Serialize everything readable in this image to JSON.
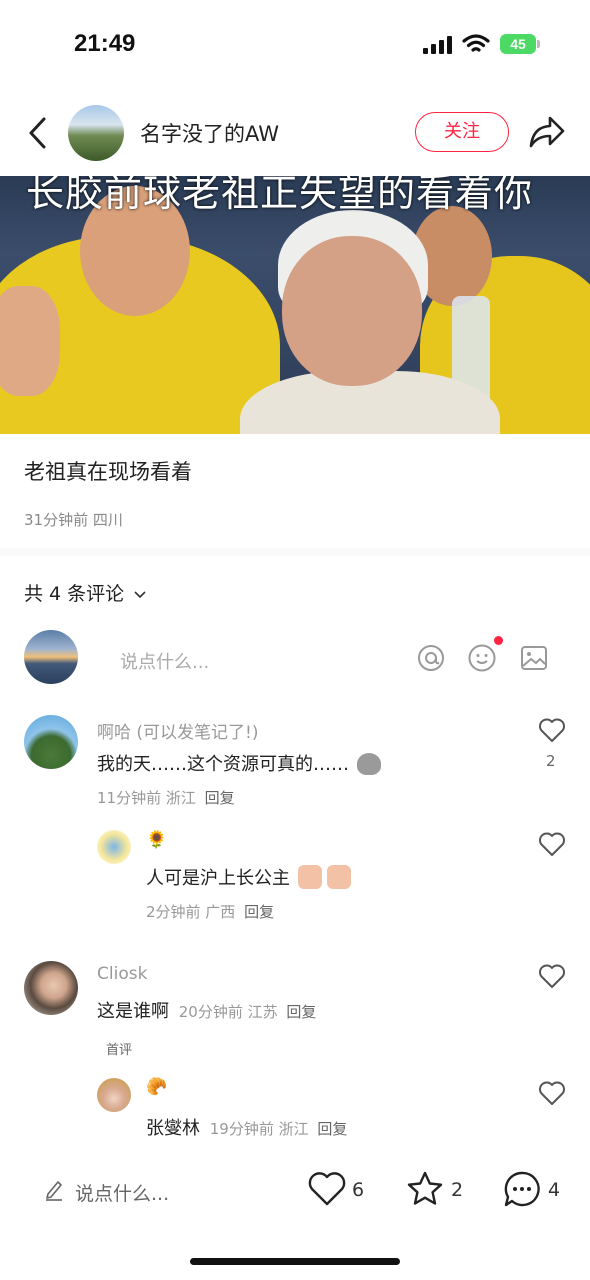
{
  "status_bar": {
    "time": "21:49",
    "battery": "45"
  },
  "nav": {
    "author_name": "名字没了的AW",
    "follow_label": "关注"
  },
  "video": {
    "caption": "长胶前球老祖正失望的看着你"
  },
  "post": {
    "title": "老祖真在现场看着",
    "meta": "31分钟前 四川"
  },
  "comments_header": {
    "count_label": "共 4 条评论"
  },
  "comment_input": {
    "placeholder": "说点什么..."
  },
  "comments": [
    {
      "name": "啊哈 (可以发笔记了!)",
      "text": "我的天……这个资源可真的……",
      "time": "11分钟前 浙江",
      "reply": "回复",
      "likes": "2"
    },
    {
      "name": "🌻",
      "text": "人可是沪上长公主",
      "time": "2分钟前 广西",
      "reply": "回复"
    },
    {
      "name": "Cliosk",
      "text": "这是谁啊",
      "time": "20分钟前 江苏",
      "reply": "回复",
      "badge": "首评"
    },
    {
      "name": "🥐",
      "text": "张燮林",
      "time": "19分钟前 浙江",
      "reply": "回复"
    }
  ],
  "bottom_bar": {
    "input_placeholder": "说点什么...",
    "likes": "6",
    "collects": "2",
    "comments": "4"
  },
  "colors": {
    "accent": "#ff2442",
    "battery": "#4cd964"
  },
  "icons": [
    "back-icon",
    "share-icon",
    "at-icon",
    "emoji-icon",
    "image-icon",
    "heart-icon",
    "star-icon",
    "chat-icon",
    "pencil-icon"
  ]
}
